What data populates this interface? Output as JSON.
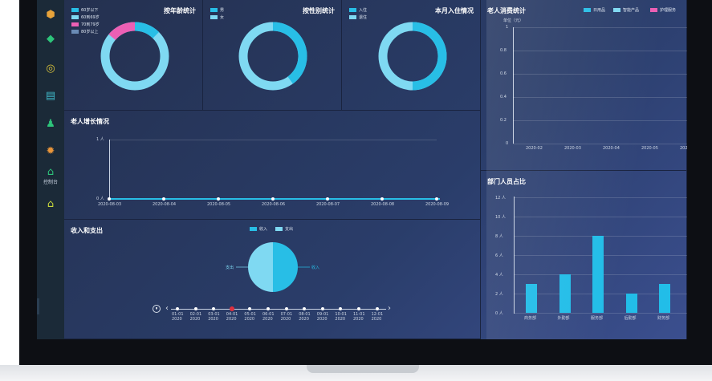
{
  "sidebar": {
    "items": [
      {
        "icon": "badge-icon",
        "color": "#e8a33a"
      },
      {
        "icon": "leaf-icon",
        "color": "#2dc47a"
      },
      {
        "icon": "target-icon",
        "color": "#d8c23a"
      },
      {
        "icon": "database-icon",
        "color": "#3fb8c8"
      },
      {
        "icon": "user-icon",
        "color": "#2dc47a"
      },
      {
        "icon": "gear-icon",
        "color": "#e8953a"
      },
      {
        "icon": "home-icon",
        "color": "#2dc47a",
        "label": "控制台",
        "active": true
      },
      {
        "icon": "home-icon",
        "color": "#c8d83a"
      }
    ]
  },
  "colors": {
    "cyan": "#28bee6",
    "lightcyan": "#7fd9f2",
    "pink": "#ec5fb4",
    "slate": "#6a8bb5",
    "bar": "#22bde8"
  },
  "age": {
    "title": "按年龄统计",
    "legend": [
      "60岁以下",
      "60到69岁",
      "70到79岁",
      "80岁以上"
    ],
    "chart_data": {
      "type": "pie",
      "categories": [
        "60岁以下",
        "60到69岁",
        "70到79岁",
        "80岁以上"
      ],
      "values": [
        0.12,
        0.73,
        0.15,
        0.0
      ]
    }
  },
  "gender": {
    "title": "按性别统计",
    "legend": [
      "男",
      "女"
    ],
    "chart_data": {
      "type": "pie",
      "categories": [
        "男",
        "女"
      ],
      "values": [
        0.4,
        0.6
      ]
    }
  },
  "checkin": {
    "title": "本月入住情况",
    "legend": [
      "入住",
      "退住"
    ],
    "chart_data": {
      "type": "pie",
      "categories": [
        "入住",
        "退住"
      ],
      "values": [
        0.5,
        0.5
      ]
    }
  },
  "growth": {
    "title": "老人增长情况",
    "chart_data": {
      "type": "line",
      "x": [
        "2020-08-03",
        "2020-08-04",
        "2020-08-05",
        "2020-08-06",
        "2020-08-07",
        "2020-08-08",
        "2020-08-09"
      ],
      "values": [
        0,
        0,
        0,
        0,
        0,
        0,
        0
      ],
      "yticks": [
        "1 人",
        "0 人"
      ],
      "ylim": [
        0,
        1
      ]
    }
  },
  "income": {
    "title": "收入和支出",
    "legend": [
      "收入",
      "支出"
    ],
    "labels": {
      "left": "支出",
      "right": "收入"
    },
    "chart_data": {
      "type": "pie",
      "categories": [
        "收入",
        "支出"
      ],
      "values": [
        0.5,
        0.5
      ]
    },
    "timeline": {
      "months": [
        "01-01",
        "02-01",
        "03-01",
        "04-01",
        "05-01",
        "06-01",
        "07-01",
        "08-01",
        "09-01",
        "10-01",
        "11-01",
        "12-01"
      ],
      "year": "2020",
      "active": 3
    }
  },
  "consumption": {
    "title": "老人消费统计",
    "unit": "单位（元）",
    "legend": [
      "日用品",
      "智能产品",
      "护理服务"
    ],
    "chart_data": {
      "type": "line",
      "x": [
        "2020-02",
        "2020-03",
        "2020-04",
        "2020-05",
        "2020"
      ],
      "yticks": [
        "1",
        "0.8",
        "0.6",
        "0.4",
        "0.2",
        "0"
      ],
      "ylim": [
        0,
        1
      ]
    }
  },
  "dept": {
    "title": "部门人员占比",
    "chart_data": {
      "type": "bar",
      "categories": [
        "商务部",
        "外勤部",
        "服务部",
        "后勤部",
        "财务部"
      ],
      "values": [
        3,
        4,
        8,
        2,
        3
      ],
      "yticks": [
        "12 人",
        "10 人",
        "8 人",
        "6 人",
        "4 人",
        "2 人",
        "0 人"
      ],
      "ylim": [
        0,
        12
      ]
    }
  }
}
